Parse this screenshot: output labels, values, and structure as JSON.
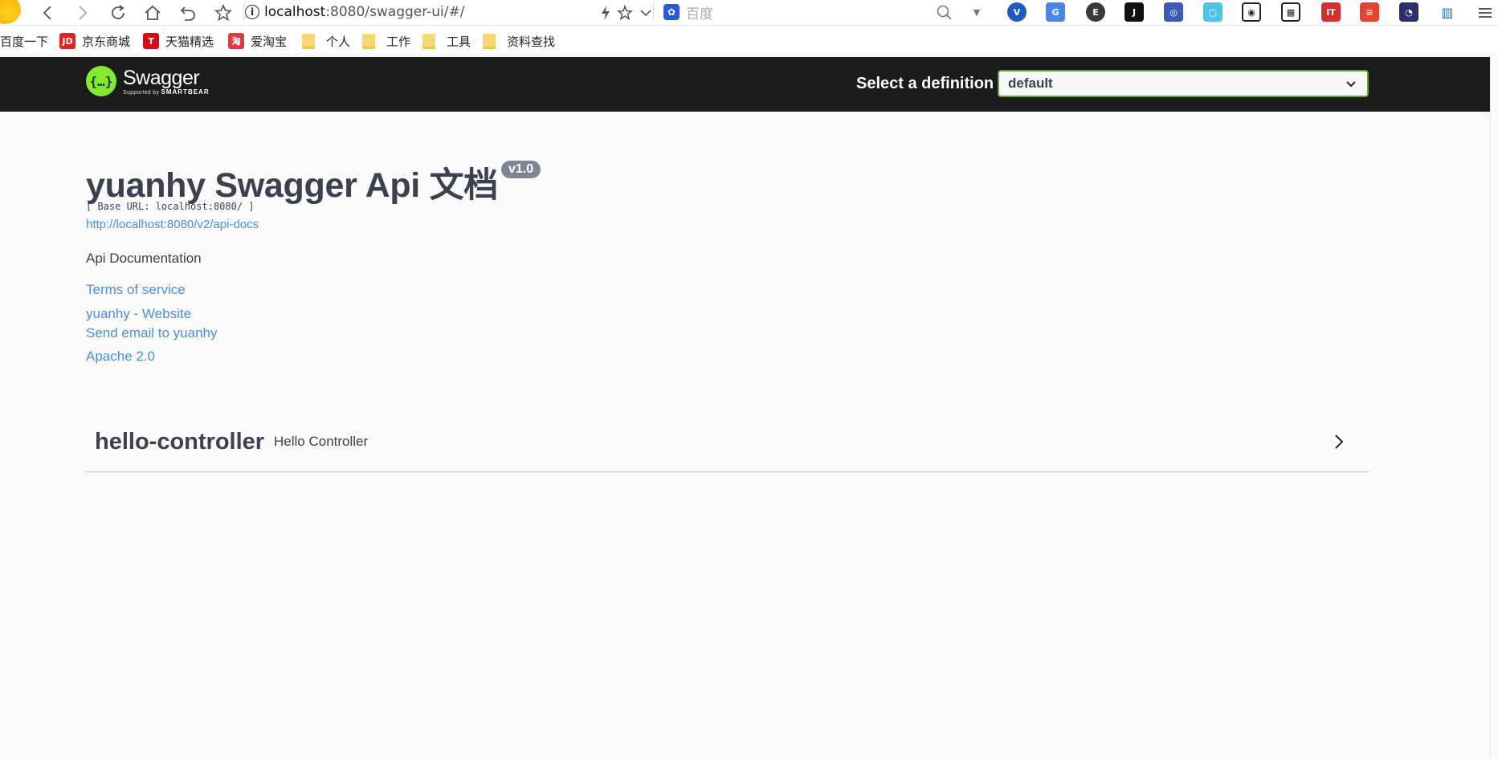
{
  "browser": {
    "address_host": "localhost",
    "address_path": ":8080/swagger-ui/#/",
    "search_engine_label": "百度",
    "bookmarks": [
      {
        "label": "百度一下"
      },
      {
        "label": "京东商城",
        "icon_text": "JD",
        "color": "#e1251b"
      },
      {
        "label": "天猫精选",
        "icon_text": "T",
        "color": "#d80c18"
      },
      {
        "label": "爱淘宝",
        "icon_text": "淘",
        "color": "#e4393c"
      },
      {
        "label": "个人"
      },
      {
        "label": "工作"
      },
      {
        "label": "工具"
      },
      {
        "label": "资料查找"
      }
    ]
  },
  "header": {
    "logo_text": "Swagger",
    "logo_sub_prefix": "Supported by",
    "logo_sub_brand": "SMARTBEAR",
    "logo_mark": "{…}",
    "definition_label": "Select a definition",
    "definition_value": "default"
  },
  "info": {
    "title": "yuanhy Swagger Api 文档",
    "version": "v1.0",
    "base_url": "[ Base URL: localhost:8080/ ]",
    "docs_url": "http://localhost:8080/v2/api-docs",
    "description": "Api Documentation",
    "terms": "Terms of service",
    "website": "yuanhy - Website",
    "email": "Send email to yuanhy",
    "license": "Apache 2.0"
  },
  "tags": [
    {
      "name": "hello-controller",
      "description": "Hello Controller"
    }
  ],
  "colors": {
    "topbar_bg": "#1b1b1b",
    "swagger_green": "#85ea2d",
    "link": "#4990e2",
    "text": "#3b4151",
    "version_badge": "#7d8492"
  }
}
